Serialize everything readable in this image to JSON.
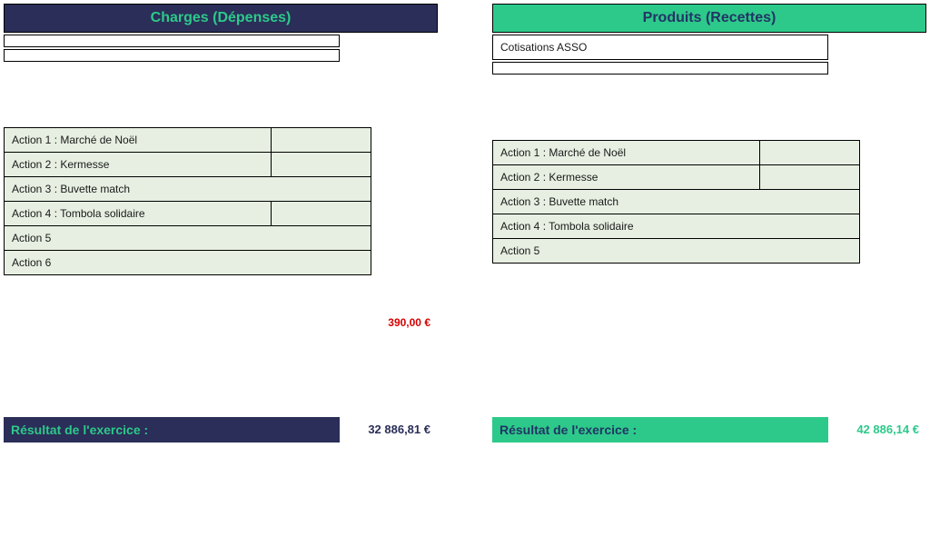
{
  "charges": {
    "header": "Charges (Dépenses)",
    "top_rows": [
      {
        "label": "",
        "amount": ""
      },
      {
        "label": "",
        "amount": ""
      }
    ],
    "actions": [
      {
        "label": "Action 1 : Marché de Noël",
        "amount": ""
      },
      {
        "label": "Action 2 : Kermesse",
        "amount": ""
      },
      {
        "label": "Action 3 : Buvette match",
        "amount": "",
        "fullspan": true
      },
      {
        "label": "Action 4 : Tombola solidaire",
        "amount": ""
      },
      {
        "label": "Action 5",
        "amount": "",
        "fullspan": true
      },
      {
        "label": "Action 6",
        "amount": "",
        "fullspan": true
      }
    ],
    "mid_amount": "390,00 €",
    "result_label": "Résultat de l'exercice :",
    "result_amount": "32 886,81 €"
  },
  "produits": {
    "header": "Produits (Recettes)",
    "top_rows": [
      {
        "label": "Cotisations ASSO",
        "amount": ""
      },
      {
        "label": "",
        "amount": ""
      }
    ],
    "actions": [
      {
        "label": "Action 1 : Marché de Noël",
        "amount": ""
      },
      {
        "label": "Action 2 : Kermesse",
        "amount": ""
      },
      {
        "label": "Action 3 : Buvette match",
        "amount": "",
        "fullspan": true
      },
      {
        "label": "Action 4 : Tombola solidaire",
        "amount": "",
        "fullspan": true
      },
      {
        "label": "Action 5",
        "amount": "",
        "fullspan": true
      }
    ],
    "result_label": "Résultat de l'exercice :",
    "result_amount": "42 886,14 €"
  }
}
